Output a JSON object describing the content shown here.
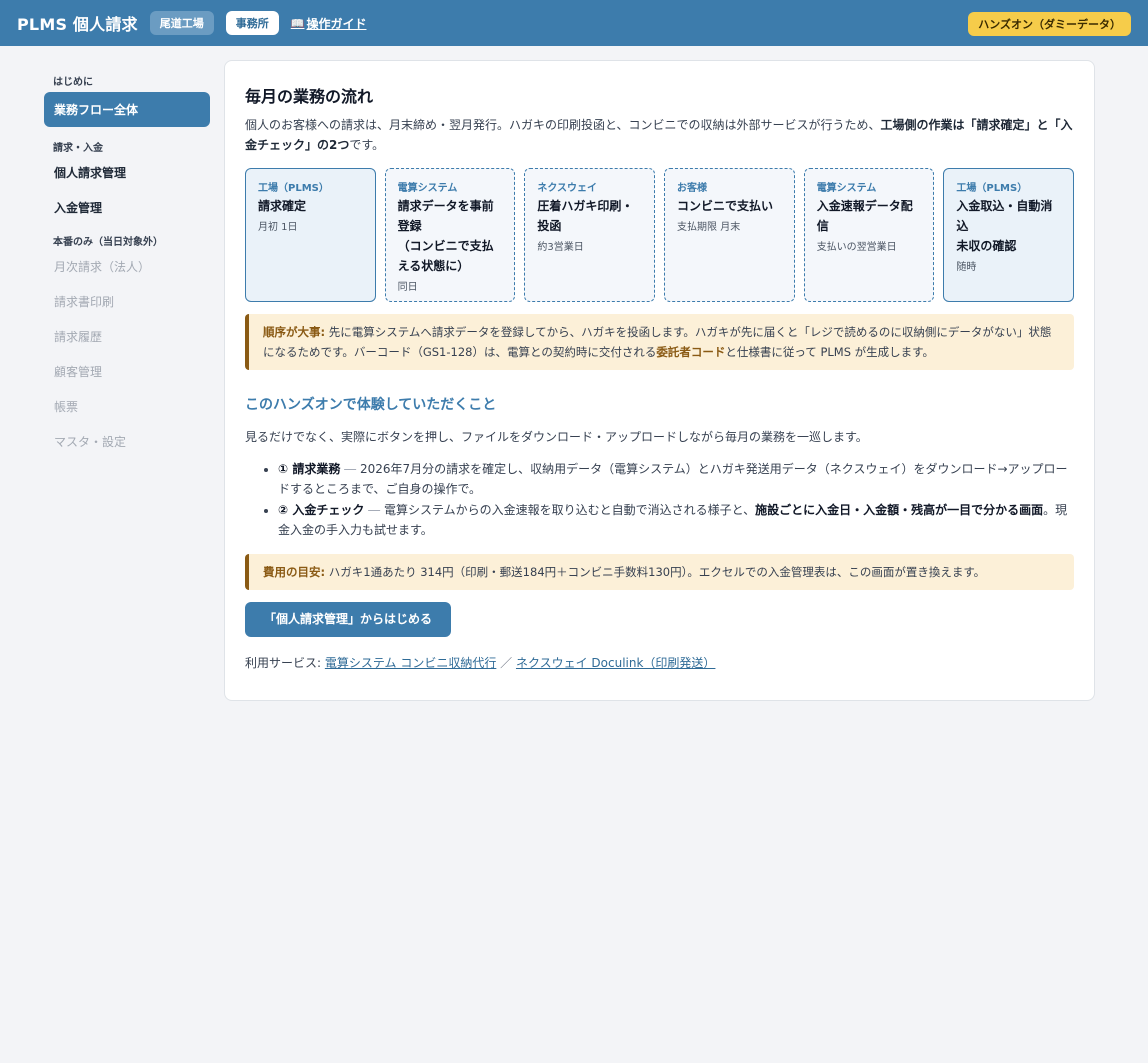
{
  "header": {
    "app_title": "PLMS 個人請求",
    "tab_factory": "尾道工場",
    "tab_office": "事務所",
    "guide_icon": "book-icon",
    "guide_label": "操作ガイド",
    "demo_badge": "ハンズオン（ダミーデータ）"
  },
  "sidebar": {
    "sections": [
      {
        "title": "はじめに",
        "items": [
          {
            "label": "業務フロー全体",
            "state": "active"
          }
        ]
      },
      {
        "title": "請求・入金",
        "items": [
          {
            "label": "個人請求管理",
            "state": "normal"
          },
          {
            "label": "入金管理",
            "state": "normal"
          }
        ]
      },
      {
        "title": "本番のみ（当日対象外）",
        "items": [
          {
            "label": "月次請求（法人）",
            "state": "disabled"
          },
          {
            "label": "請求書印刷",
            "state": "disabled"
          },
          {
            "label": "請求履歴",
            "state": "disabled"
          },
          {
            "label": "顧客管理",
            "state": "disabled"
          },
          {
            "label": "帳票",
            "state": "disabled"
          },
          {
            "label": "マスタ・設定",
            "state": "disabled"
          }
        ]
      }
    ]
  },
  "main": {
    "title": "毎月の業務の流れ",
    "intro_plain": "個人のお客様への請求は、月末締め・翌月発行。ハガキの印刷投函と、コンビニでの収納は外部サービスが行うため、",
    "intro_bold": "工場側の作業は「請求確定」と「入金チェック」の2つ",
    "intro_tail": "です。",
    "flow": [
      {
        "actor": "工場（PLMS）",
        "title": [
          "請求確定"
        ],
        "timing": "月初 1日",
        "kind": "factory"
      },
      {
        "actor": "電算システム",
        "title": [
          "請求データを事前登録",
          "（コンビニで支払える状態に）"
        ],
        "timing": "同日",
        "kind": "external"
      },
      {
        "actor": "ネクスウェイ",
        "title": [
          "圧着ハガキ印刷・投函"
        ],
        "timing": "約3営業日",
        "kind": "external"
      },
      {
        "actor": "お客様",
        "title": [
          "コンビニで支払い"
        ],
        "timing": "支払期限 月末",
        "kind": "external"
      },
      {
        "actor": "電算システム",
        "title": [
          "入金速報データ配信"
        ],
        "timing": "支払いの翌営業日",
        "kind": "external"
      },
      {
        "actor": "工場（PLMS）",
        "title": [
          "入金取込・自動消込",
          "未収の確認"
        ],
        "timing": "随時",
        "kind": "factory"
      }
    ],
    "order_note": {
      "label": "順序が大事:",
      "text1": " 先に電算システムへ請求データを登録してから、ハガキを投函します。ハガキが先に届くと「レジで読めるのに収納側にデータがない」状態になるためです。バーコード（GS1-128）は、電算との契約時に交付される",
      "highlight": "委託者コード",
      "text2": "と仕様書に従って PLMS が生成します。"
    },
    "handson_title": "このハンズオンで体験していただくこと",
    "handson_intro": "見るだけでなく、実際にボタンを押し、ファイルをダウンロード・アップロードしながら毎月の業務を一巡します。",
    "bullets": [
      {
        "head": "① 請求業務",
        "dash": " ― ",
        "text": "2026年7月分の請求を確定し、収納用データ（電算システム）とハガキ発送用データ（ネクスウェイ）をダウンロード→アップロードするところまで、ご自身の操作で。",
        "bold": "",
        "tail": ""
      },
      {
        "head": "② 入金チェック",
        "dash": " ― ",
        "text": "電算システムからの入金速報を取り込むと自動で消込される様子と、",
        "bold": "施設ごとに入金日・入金額・残高が一目で分かる画面",
        "tail": "。現金入金の手入力も試せます。"
      }
    ],
    "cost_note": {
      "label": "費用の目安:",
      "text": " ハガキ1通あたり 314円（印刷・郵送184円＋コンビニ手数料130円）。エクセルでの入金管理表は、この画面が置き換えます。"
    },
    "start_button": "「個人請求管理」からはじめる",
    "services_label": "利用サービス: ",
    "service_links": [
      "電算システム コンビニ収納代行",
      "ネクスウェイ Doculink（印刷発送）"
    ],
    "services_sep": " ／ "
  }
}
